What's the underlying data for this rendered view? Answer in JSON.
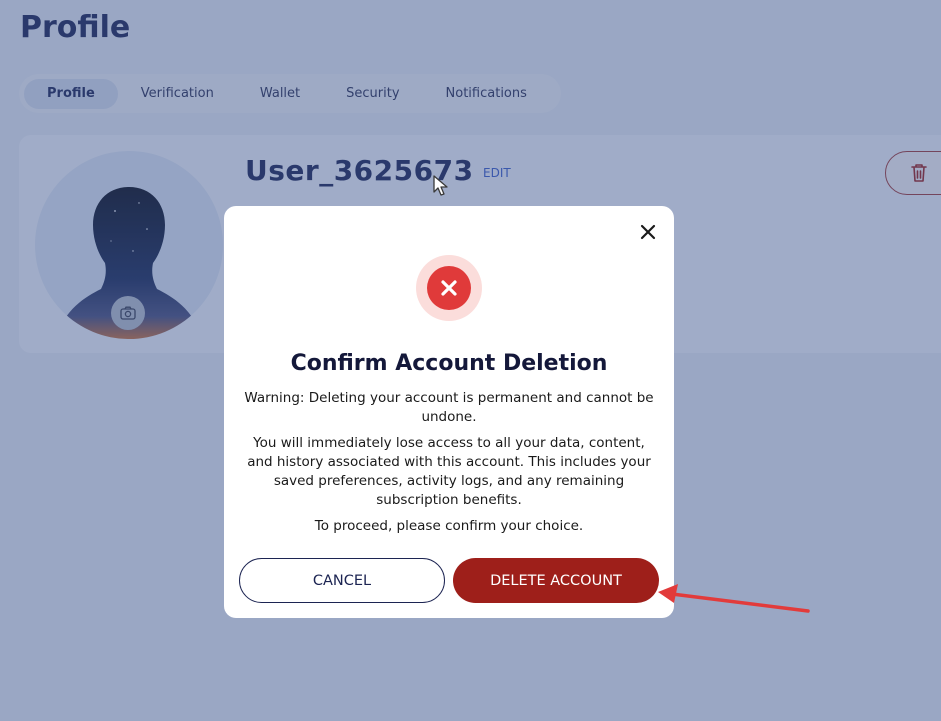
{
  "header": {
    "title": "Profile"
  },
  "tabs": [
    {
      "label": "Profile"
    },
    {
      "label": "Verification"
    },
    {
      "label": "Wallet"
    },
    {
      "label": "Security"
    },
    {
      "label": "Notifications"
    }
  ],
  "profile": {
    "username": "User_3625673",
    "edit_label": "EDIT"
  },
  "icons": {
    "camera": "camera-icon",
    "trash": "trash-icon",
    "close": "close-icon",
    "error": "error-x-icon"
  },
  "modal": {
    "title": "Confirm Account Deletion",
    "warning": "Warning: Deleting your account is permanent and cannot be undone.",
    "details": "You will immediately lose access to all your data, content, and history associated with this account. This includes your saved preferences, activity logs, and any remaining subscription benefits.",
    "confirm_prompt": "To proceed, please confirm your choice.",
    "cancel_label": "CANCEL",
    "delete_label": "DELETE ACCOUNT"
  },
  "colors": {
    "accent_navy": "#1c2452",
    "danger": "#9e1f1a",
    "error_icon": "#e03a3a",
    "annotation_arrow": "#e23b3b"
  }
}
